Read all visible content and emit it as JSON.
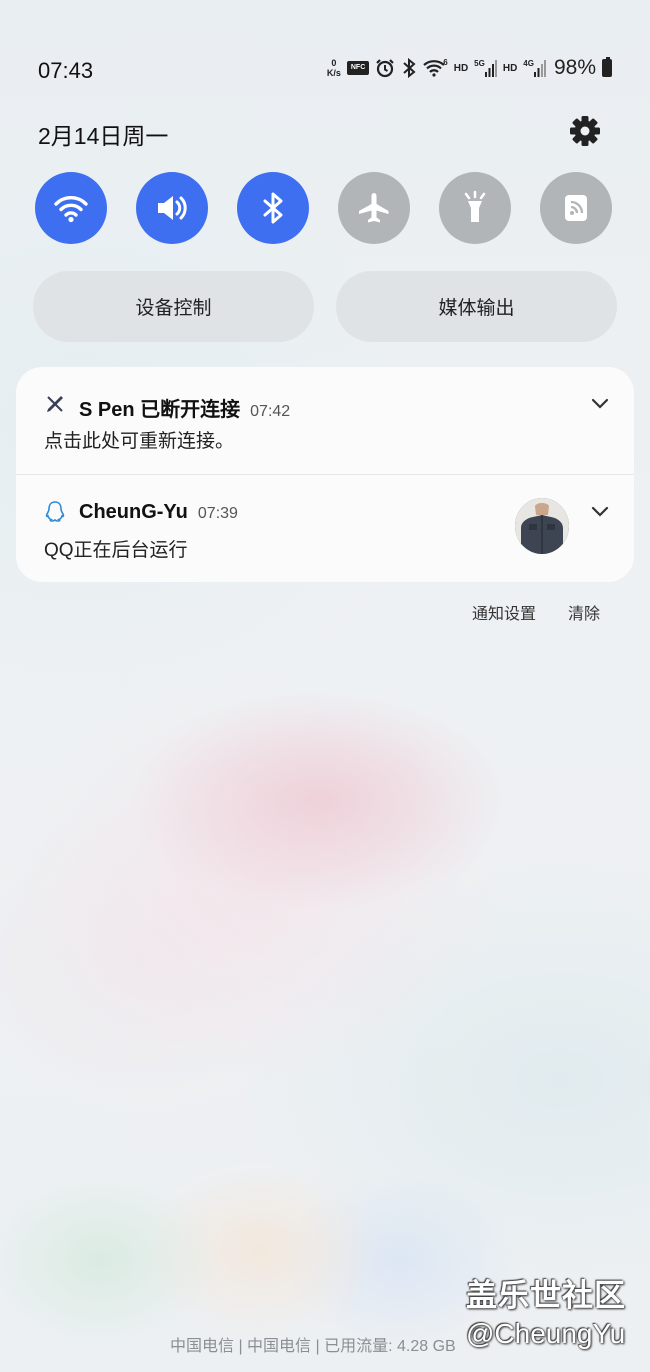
{
  "status_bar": {
    "time": "07:43",
    "net_speed_value": "0",
    "net_speed_unit": "K/s",
    "nfc_label": "NFC",
    "wifi_gen": "6",
    "hd_1": "HD",
    "sig_1": "5G",
    "hd_2": "HD",
    "sig_2": "4G",
    "battery": "98%",
    "icons": [
      "nfc-icon",
      "alarm-icon",
      "bluetooth-icon",
      "wifi-icon",
      "signal-icon",
      "battery-icon"
    ]
  },
  "header": {
    "date": "2月14日周一"
  },
  "quick_toggles": [
    {
      "name": "wifi",
      "state": "on"
    },
    {
      "name": "sound",
      "state": "on"
    },
    {
      "name": "bluetooth",
      "state": "on"
    },
    {
      "name": "airplane-mode",
      "state": "off"
    },
    {
      "name": "flashlight",
      "state": "off"
    },
    {
      "name": "nfc",
      "state": "off"
    }
  ],
  "buttons": {
    "device_control": "设备控制",
    "media_output": "媒体输出"
  },
  "notifications": [
    {
      "app_icon": "s-pen-icon",
      "title": "S Pen 已断开连接",
      "time": "07:42",
      "body": "点击此处可重新连接。"
    },
    {
      "app_icon": "qq-icon",
      "title": "CheunG-Yu",
      "time": "07:39",
      "body": "QQ正在后台运行"
    }
  ],
  "notification_actions": {
    "settings": "通知设置",
    "clear": "清除"
  },
  "footer": {
    "carrier": "中国电信 | 中国电信 | 已用流量: 4.28 GB"
  },
  "watermark": {
    "line1": "盖乐世社区",
    "line2": "@CheungYu"
  },
  "colors": {
    "toggle_on": "#3e6ff0",
    "toggle_off": "#b2b5b8",
    "card": "#fbfbfc"
  }
}
